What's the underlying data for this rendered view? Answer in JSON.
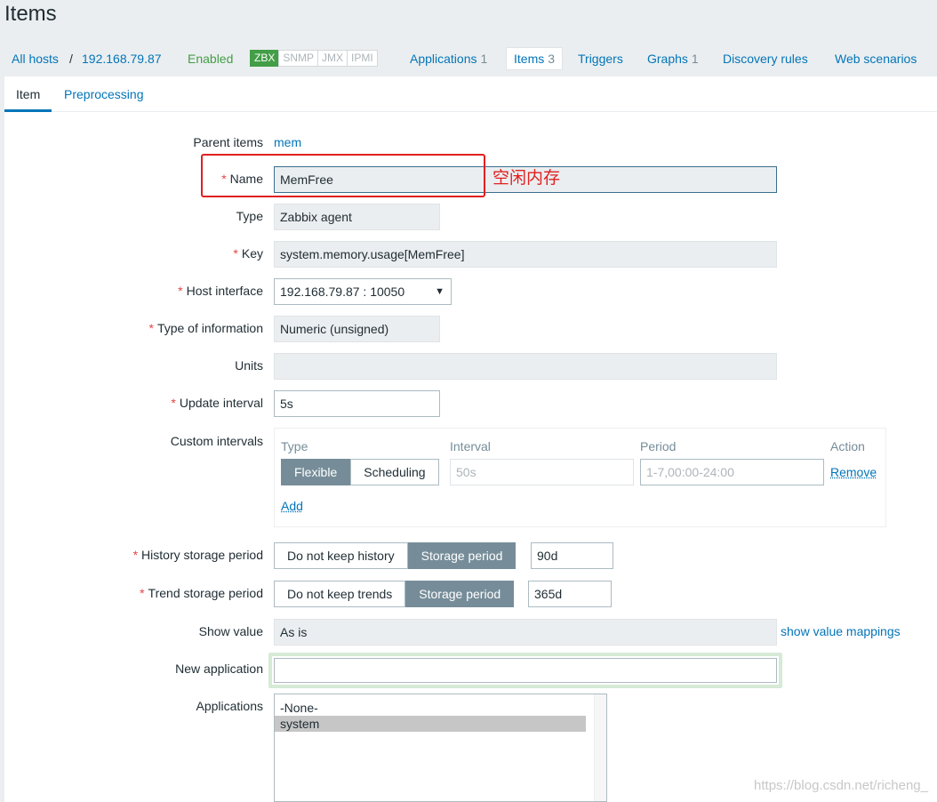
{
  "page": {
    "title": "Items"
  },
  "host_nav": {
    "all_hosts": "All hosts",
    "separator": "/",
    "host": "192.168.79.87",
    "status": "Enabled",
    "badges": {
      "zbx": "ZBX",
      "snmp": "SNMP",
      "jmx": "JMX",
      "ipmi": "IPMI"
    },
    "applications": {
      "label": "Applications",
      "count": "1"
    },
    "items": {
      "label": "Items",
      "count": "3"
    },
    "triggers": {
      "label": "Triggers"
    },
    "graphs": {
      "label": "Graphs",
      "count": "1"
    },
    "discovery_rules": {
      "label": "Discovery rules"
    },
    "web_scenarios": {
      "label": "Web scenarios"
    }
  },
  "tabs": {
    "item": "Item",
    "preprocessing": "Preprocessing"
  },
  "form": {
    "required_mark": "*",
    "parent_items": {
      "label": "Parent items",
      "value": "mem"
    },
    "name": {
      "label": "Name",
      "value": "MemFree"
    },
    "annotation": "空闲内存",
    "type": {
      "label": "Type",
      "value": "Zabbix agent"
    },
    "key": {
      "label": "Key",
      "value": "system.memory.usage[MemFree]"
    },
    "host_interface": {
      "label": "Host interface",
      "value": "192.168.79.87 : 10050",
      "caret": "▼"
    },
    "type_of_information": {
      "label": "Type of information",
      "value": "Numeric (unsigned)"
    },
    "units": {
      "label": "Units",
      "value": ""
    },
    "update_interval": {
      "label": "Update interval",
      "value": "5s"
    },
    "custom_intervals": {
      "label": "Custom intervals",
      "col_type": "Type",
      "col_interval": "Interval",
      "col_period": "Period",
      "col_action": "Action",
      "flexible": "Flexible",
      "scheduling": "Scheduling",
      "interval_placeholder": "50s",
      "period_placeholder": "1-7,00:00-24:00",
      "remove": "Remove",
      "add": "Add"
    },
    "history": {
      "label": "History storage period",
      "opt_off": "Do not keep history",
      "opt_on": "Storage period",
      "value": "90d"
    },
    "trend": {
      "label": "Trend storage period",
      "opt_off": "Do not keep trends",
      "opt_on": "Storage period",
      "value": "365d"
    },
    "show_value": {
      "label": "Show value",
      "value": "As is",
      "link": "show value mappings"
    },
    "new_application": {
      "label": "New application",
      "value": ""
    },
    "applications": {
      "label": "Applications",
      "options": [
        "-None-",
        "system"
      ],
      "selected": "system"
    }
  },
  "watermark": "https://blog.csdn.net/richeng_"
}
